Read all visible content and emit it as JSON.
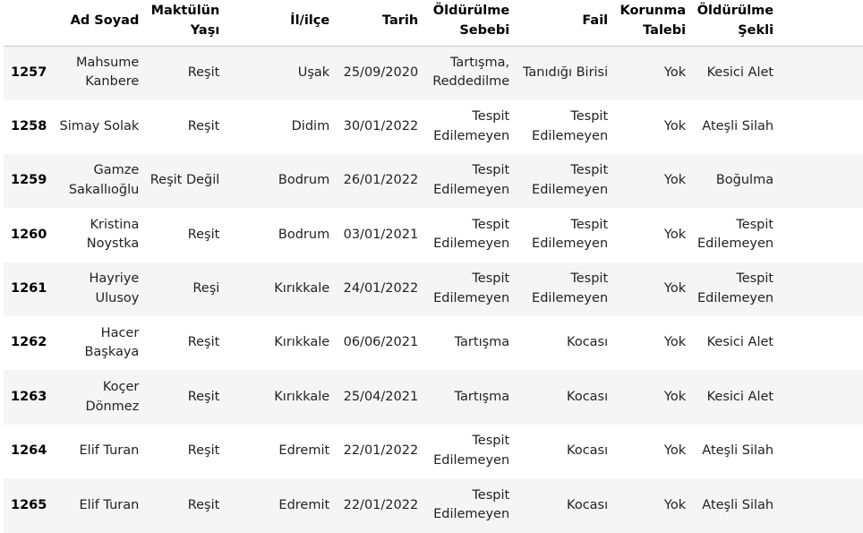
{
  "table": {
    "columns": [
      "",
      "Ad Soyad",
      "Maktülün Yaşı",
      "İl/ilçe",
      "Tarih",
      "Öldürülme Sebebi",
      "Fail",
      "Korunma Talebi",
      "Öldürülme Şekli",
      ""
    ],
    "rows": [
      {
        "index": "1257",
        "cells": [
          "Mahsume Kanbere",
          "Reşit",
          "Uşak",
          "25/09/2020",
          "Tartışma, Reddedilme",
          "Tanıdığı Birisi",
          "Yok",
          "Kesici Alet",
          ""
        ]
      },
      {
        "index": "1258",
        "cells": [
          "Simay Solak",
          "Reşit",
          "Didim",
          "30/01/2022",
          "Tespit Edilemeyen",
          "Tespit Edilemeyen",
          "Yok",
          "Ateşli Silah",
          ""
        ]
      },
      {
        "index": "1259",
        "cells": [
          "Gamze Sakallıoğlu",
          "Reşit Değil",
          "Bodrum",
          "26/01/2022",
          "Tespit Edilemeyen",
          "Tespit Edilemeyen",
          "Yok",
          "Boğulma",
          ""
        ]
      },
      {
        "index": "1260",
        "cells": [
          "Kristina Noystka",
          "Reşit",
          "Bodrum",
          "03/01/2021",
          "Tespit Edilemeyen",
          "Tespit Edilemeyen",
          "Yok",
          "Tespit Edilemeyen",
          ""
        ]
      },
      {
        "index": "1261",
        "cells": [
          "Hayriye Ulusoy",
          "Reşi",
          "Kırıkkale",
          "24/01/2022",
          "Tespit Edilemeyen",
          "Tespit Edilemeyen",
          "Yok",
          "Tespit Edilemeyen",
          ""
        ]
      },
      {
        "index": "1262",
        "cells": [
          "Hacer Başkaya",
          "Reşit",
          "Kırıkkale",
          "06/06/2021",
          "Tartışma",
          "Kocası",
          "Yok",
          "Kesici Alet",
          ""
        ]
      },
      {
        "index": "1263",
        "cells": [
          "Koçer Dönmez",
          "Reşit",
          "Kırıkkale",
          "25/04/2021",
          "Tartışma",
          "Kocası",
          "Yok",
          "Kesici Alet",
          ""
        ]
      },
      {
        "index": "1264",
        "cells": [
          "Elif Turan",
          "Reşit",
          "Edremit",
          "22/01/2022",
          "Tespit Edilemeyen",
          "Kocası",
          "Yok",
          "Ateşli Silah",
          ""
        ]
      },
      {
        "index": "1265",
        "cells": [
          "Elif Turan",
          "Reşit",
          "Edremit",
          "22/01/2022",
          "Tespit Edilemeyen",
          "Kocası",
          "Yok",
          "Ateşli Silah",
          ""
        ]
      }
    ]
  }
}
